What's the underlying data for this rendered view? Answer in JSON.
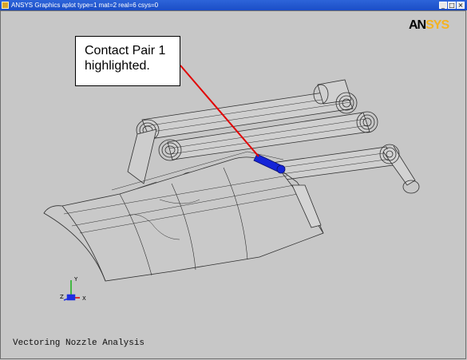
{
  "window": {
    "title": "ANSYS Graphics   aplot   type=1 mat=2 real=6 csys=0",
    "buttons": {
      "minimize": "_",
      "restore": "□",
      "close": "×"
    }
  },
  "logo": {
    "part1": "AN",
    "part2": "SYS"
  },
  "callout": {
    "line1": "Contact Pair 1",
    "line2": "highlighted."
  },
  "footer": {
    "caption": "Vectoring Nozzle Analysis"
  },
  "triad": {
    "x_label": "X",
    "y_label": "Y",
    "z_label": "Z"
  },
  "colors": {
    "background": "#c7c7c7",
    "leader_line": "#e10000",
    "highlight": "#1424d8",
    "wireframe": "#2f2f2f",
    "logo_accent": "#f5b320"
  },
  "icons": [
    "ansys-app-icon",
    "minimize-icon",
    "restore-icon",
    "close-icon",
    "coordinate-triad-icon"
  ]
}
